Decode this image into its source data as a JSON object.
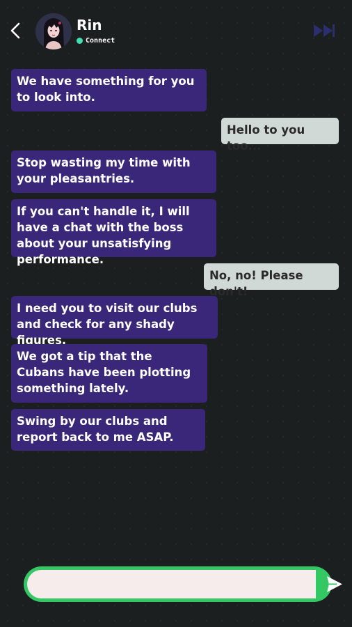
{
  "header": {
    "contact_name": "Rin",
    "status": "Connect",
    "status_color": "#3fe0b0"
  },
  "icons": {
    "back": "chevron-left-icon",
    "fast_forward": "fast-forward-icon",
    "send": "send-icon"
  },
  "messages": [
    {
      "from": "Rin",
      "text": "We have something for you to look into."
    },
    {
      "from": "You",
      "text": "Hello to you too..."
    },
    {
      "from": "Rin",
      "text": "Stop wasting my time with your pleasantries."
    },
    {
      "from": "Rin",
      "text": "If you can't handle it, I will have a chat with the boss about your unsatisfying performance."
    },
    {
      "from": "You",
      "text": "No, no! Please don't!"
    },
    {
      "from": "Rin",
      "text": "I need you to visit our clubs and check for any shady figures."
    },
    {
      "from": "Rin",
      "text": "We got a tip that the Cubans have been plotting something lately."
    },
    {
      "from": "Rin",
      "text": "Swing by our clubs and report back to me ASAP."
    }
  ],
  "composer": {
    "value": "",
    "placeholder": ""
  },
  "colors": {
    "background": "#1b1f1f",
    "incoming_bubble": "#3b2779",
    "outgoing_bubble": "#d1d9d6",
    "accent_green": "#34c864",
    "input_fill": "#f7ecec"
  }
}
